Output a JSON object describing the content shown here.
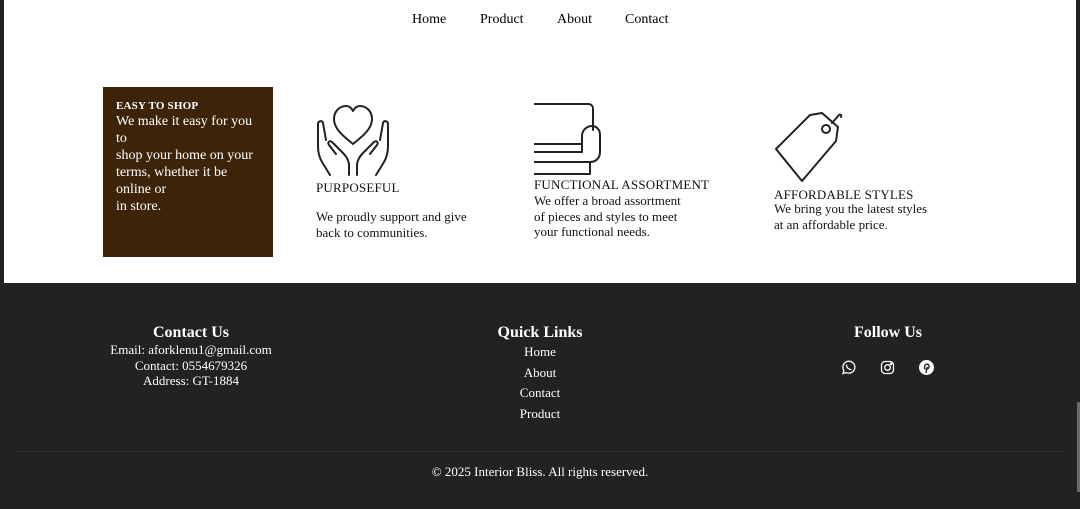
{
  "nav": {
    "items": [
      "Home",
      "Product",
      "About",
      "Contact"
    ]
  },
  "shop": {
    "title": "EASY TO SHOP",
    "text": "We make it easy for you\nto\nshop your home on your\nterms, whether it be\nonline or\nin store."
  },
  "features": [
    {
      "icon": "heart-hands-icon",
      "title": "PURPOSEFUL",
      "text": "We proudly support and give\nback to communities."
    },
    {
      "icon": "sofa-icon",
      "title": "FUNCTIONAL ASSORTMENT",
      "text": "We offer a broad assortment\nof pieces and styles to meet\nyour functional needs."
    },
    {
      "icon": "price-tag-icon",
      "title": "AFFORDABLE STYLES",
      "text": "We bring you the latest styles\nat an affordable price."
    }
  ],
  "footer": {
    "contact": {
      "heading": "Contact Us",
      "email": "Email: aforklenu1@gmail.com",
      "phone": "Contact: 0554679326",
      "address": "Address: GT-1884"
    },
    "quick_links": {
      "heading": "Quick Links",
      "items": [
        "Home",
        "About",
        "Contact",
        "Product"
      ]
    },
    "follow": {
      "heading": "Follow Us",
      "icons": [
        "whatsapp-icon",
        "instagram-icon",
        "pinterest-icon"
      ]
    },
    "copyright": "© 2025 Interior Bliss. All rights reserved."
  },
  "colors": {
    "brown_box": "#3d2409",
    "footer_bg": "#222222",
    "page_bg": "#ffffff"
  }
}
